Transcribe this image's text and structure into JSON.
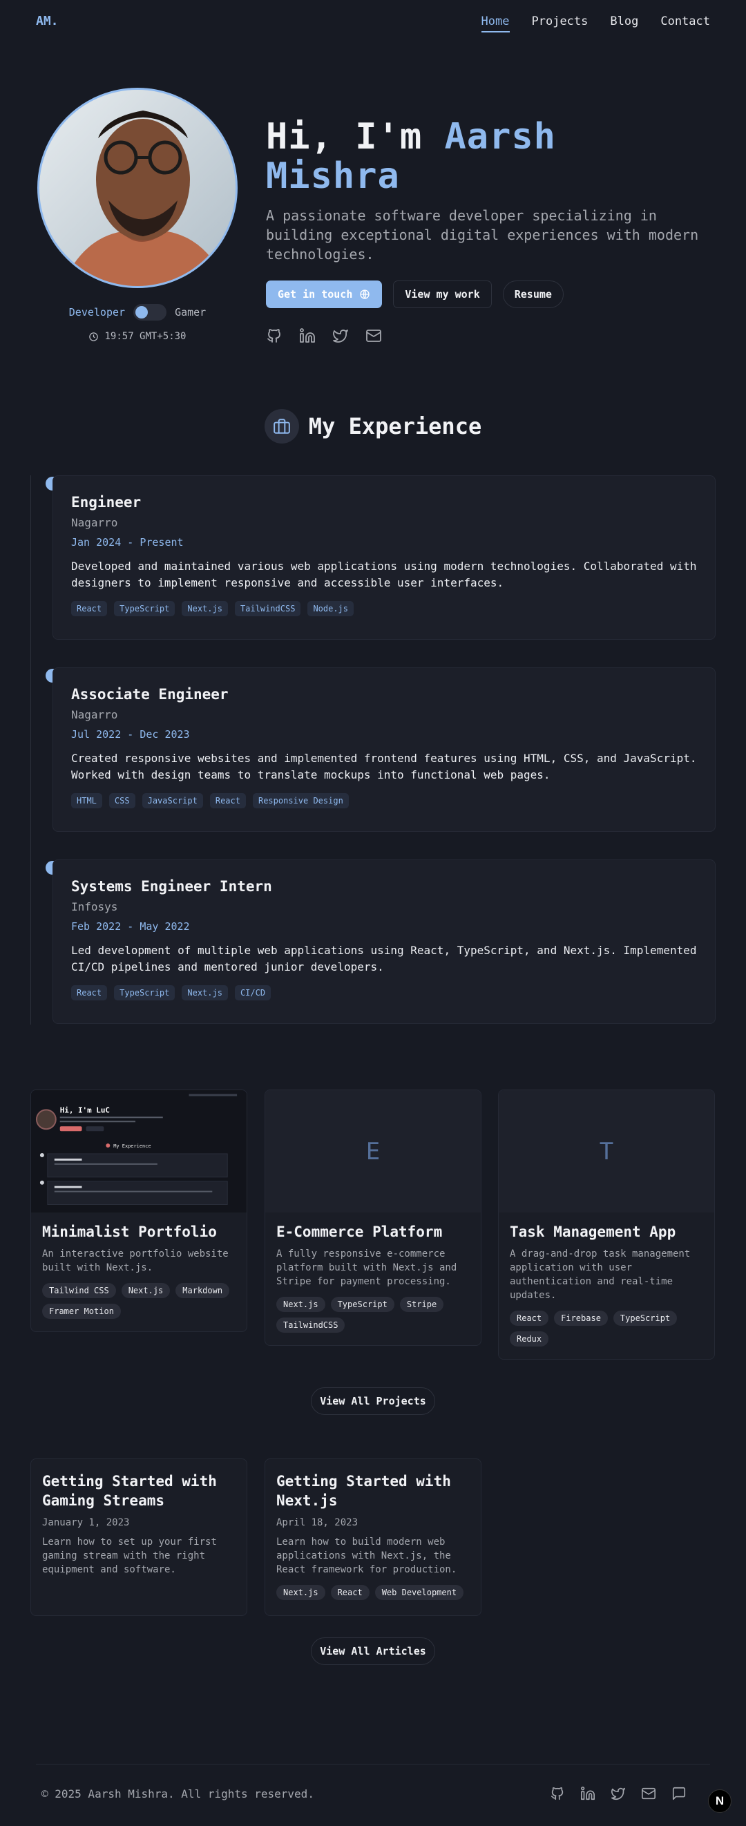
{
  "nav": {
    "logo": "AM.",
    "links": [
      "Home",
      "Projects",
      "Blog",
      "Contact"
    ]
  },
  "hero": {
    "greeting": "Hi, I'm ",
    "name": "Aarsh Mishra",
    "description": "A passionate software developer specializing in building exceptional digital experiences with modern technologies.",
    "buttons": {
      "primary": "Get in touch",
      "secondary": "View my work",
      "resume": "Resume"
    },
    "toggle": {
      "left": "Developer",
      "right": "Gamer"
    },
    "time": "19:57 GMT+5:30",
    "social_icons": [
      "github-icon",
      "linkedin-icon",
      "twitter-icon",
      "mail-icon"
    ]
  },
  "experience": {
    "title": "My Experience",
    "jobs": [
      {
        "title": "Engineer",
        "company": "Nagarro",
        "period": "Jan 2024 - Present",
        "description": "Developed and maintained various web applications using modern technologies. Collaborated with designers to implement responsive and accessible user interfaces.",
        "tags": [
          "React",
          "TypeScript",
          "Next.js",
          "TailwindCSS",
          "Node.js"
        ]
      },
      {
        "title": "Associate Engineer",
        "company": "Nagarro",
        "period": "Jul 2022 - Dec 2023",
        "description": "Created responsive websites and implemented frontend features using HTML, CSS, and JavaScript. Worked with design teams to translate mockups into functional web pages.",
        "tags": [
          "HTML",
          "CSS",
          "JavaScript",
          "React",
          "Responsive Design"
        ]
      },
      {
        "title": "Systems Engineer Intern",
        "company": "Infosys",
        "period": "Feb 2022 - May 2022",
        "description": "Led development of multiple web applications using React, TypeScript, and Next.js. Implemented CI/CD pipelines and mentored junior developers.",
        "tags": [
          "React",
          "TypeScript",
          "Next.js",
          "CI/CD"
        ]
      }
    ]
  },
  "projects": {
    "items": [
      {
        "thumb": "",
        "title": "Minimalist Portfolio",
        "description": "An interactive portfolio website built with Next.js.",
        "tags": [
          "Tailwind CSS",
          "Next.js",
          "Markdown",
          "Framer Motion"
        ]
      },
      {
        "thumb": "E",
        "title": "E-Commerce Platform",
        "description": "A fully responsive e-commerce platform built with Next.js and Stripe for payment processing.",
        "tags": [
          "Next.js",
          "TypeScript",
          "Stripe",
          "TailwindCSS"
        ]
      },
      {
        "thumb": "T",
        "title": "Task Management App",
        "description": "A drag-and-drop task management application with user authentication and real-time updates.",
        "tags": [
          "React",
          "Firebase",
          "TypeScript",
          "Redux"
        ]
      }
    ],
    "view_all": "View All Projects",
    "preview": {
      "heading": "Hi, I'm LuC",
      "section": "My Experience"
    }
  },
  "articles": {
    "items": [
      {
        "title": "Getting Started with Gaming Streams",
        "date": "January 1, 2023",
        "description": "Learn how to set up your first gaming stream with the right equipment and software.",
        "tags": []
      },
      {
        "title": "Getting Started with Next.js",
        "date": "April 18, 2023",
        "description": "Learn how to build modern web applications with Next.js, the React framework for production.",
        "tags": [
          "Next.js",
          "React",
          "Web Development"
        ]
      }
    ],
    "view_all": "View All Articles"
  },
  "footer": {
    "copyright": "© 2025 Aarsh Mishra. All rights reserved.",
    "icons": [
      "github-icon",
      "linkedin-icon",
      "twitter-icon",
      "mail-icon",
      "chat-icon"
    ],
    "badge": "N"
  },
  "colors": {
    "accent": "#8fb9ee",
    "background": "#171a23",
    "card": "#1c1f29"
  }
}
